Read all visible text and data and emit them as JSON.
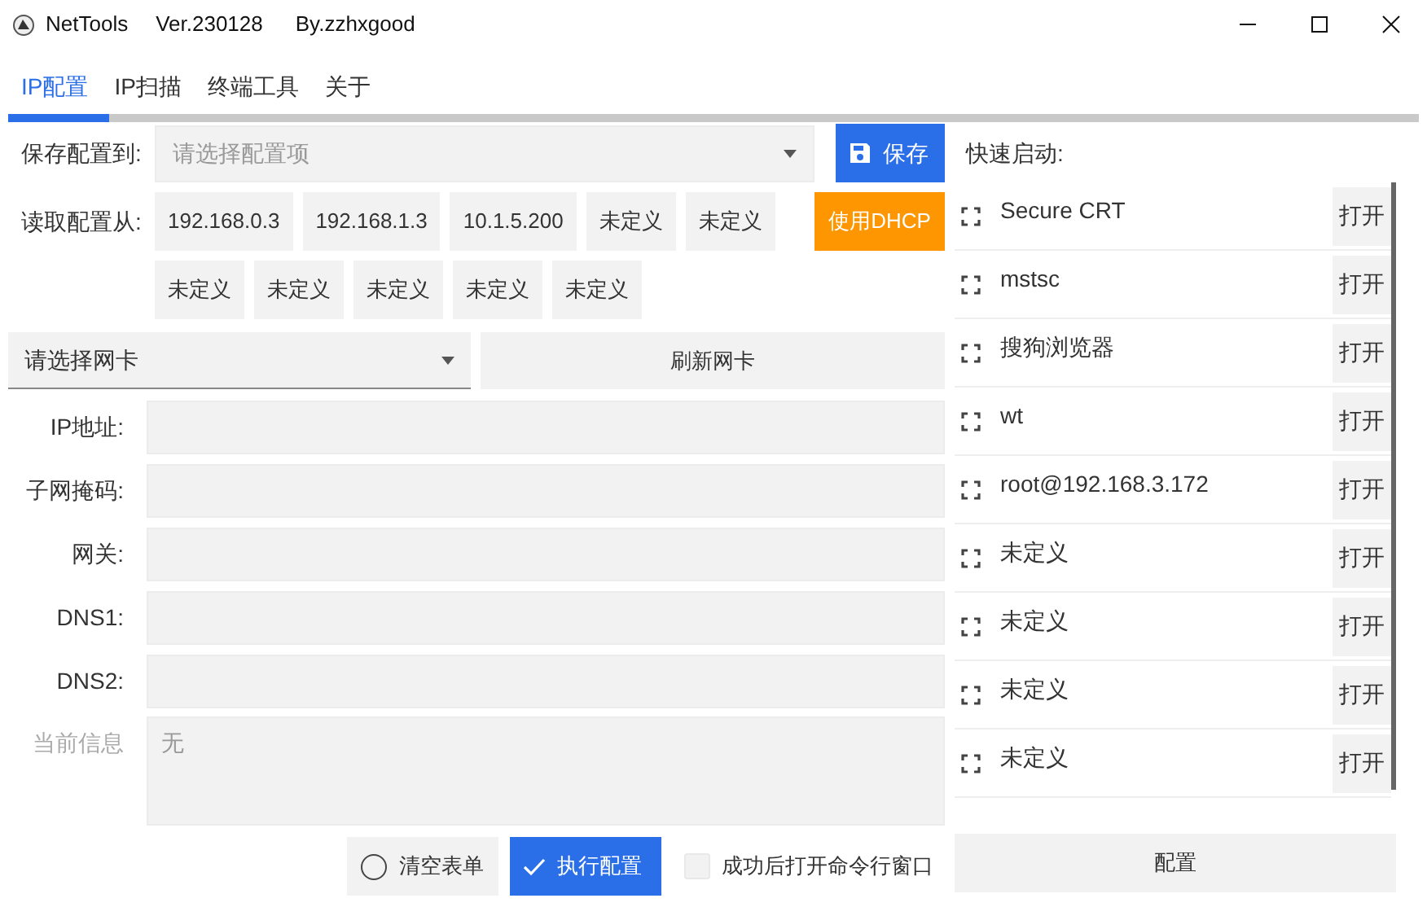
{
  "window": {
    "title": "NetTools",
    "version": "Ver.230128",
    "author": "By.zzhxgood"
  },
  "tabs": [
    {
      "label": "IP配置",
      "selected": true
    },
    {
      "label": "IP扫描",
      "selected": false
    },
    {
      "label": "终端工具",
      "selected": false
    },
    {
      "label": "关于",
      "selected": false
    }
  ],
  "save_config": {
    "label": "保存配置到:",
    "placeholder": "请选择配置项",
    "button": "保存"
  },
  "load_config": {
    "label": "读取配置从:",
    "presets": [
      "192.168.0.3",
      "192.168.1.3",
      "10.1.5.200",
      "未定义",
      "未定义"
    ],
    "dhcp_button": "使用DHCP",
    "more_presets": [
      "未定义",
      "未定义",
      "未定义",
      "未定义",
      "未定义"
    ]
  },
  "nic": {
    "placeholder": "请选择网卡",
    "refresh_button": "刷新网卡"
  },
  "fields": [
    {
      "label": "IP地址:"
    },
    {
      "label": "子网掩码:"
    },
    {
      "label": "网关:"
    },
    {
      "label": "DNS1:"
    },
    {
      "label": "DNS2:"
    }
  ],
  "info": {
    "label": "当前信息",
    "value": "无"
  },
  "actions": {
    "clear_button": "清空表单",
    "clear_checked": false,
    "run_button": "执行配置",
    "open_cmd_label": "成功后打开命令行窗口",
    "open_cmd_checked": false
  },
  "quick_launch": {
    "title": "快速启动:",
    "items": [
      {
        "name": "Secure CRT",
        "button": "打开"
      },
      {
        "name": "mstsc",
        "button": "打开"
      },
      {
        "name": "搜狗浏览器",
        "button": "打开"
      },
      {
        "name": "wt",
        "button": "打开"
      },
      {
        "name": "root@192.168.3.172",
        "button": "打开"
      },
      {
        "name": "未定义",
        "button": "打开"
      },
      {
        "name": "未定义",
        "button": "打开"
      },
      {
        "name": "未定义",
        "button": "打开"
      },
      {
        "name": "未定义",
        "button": "打开"
      }
    ],
    "config_button": "配置"
  }
}
